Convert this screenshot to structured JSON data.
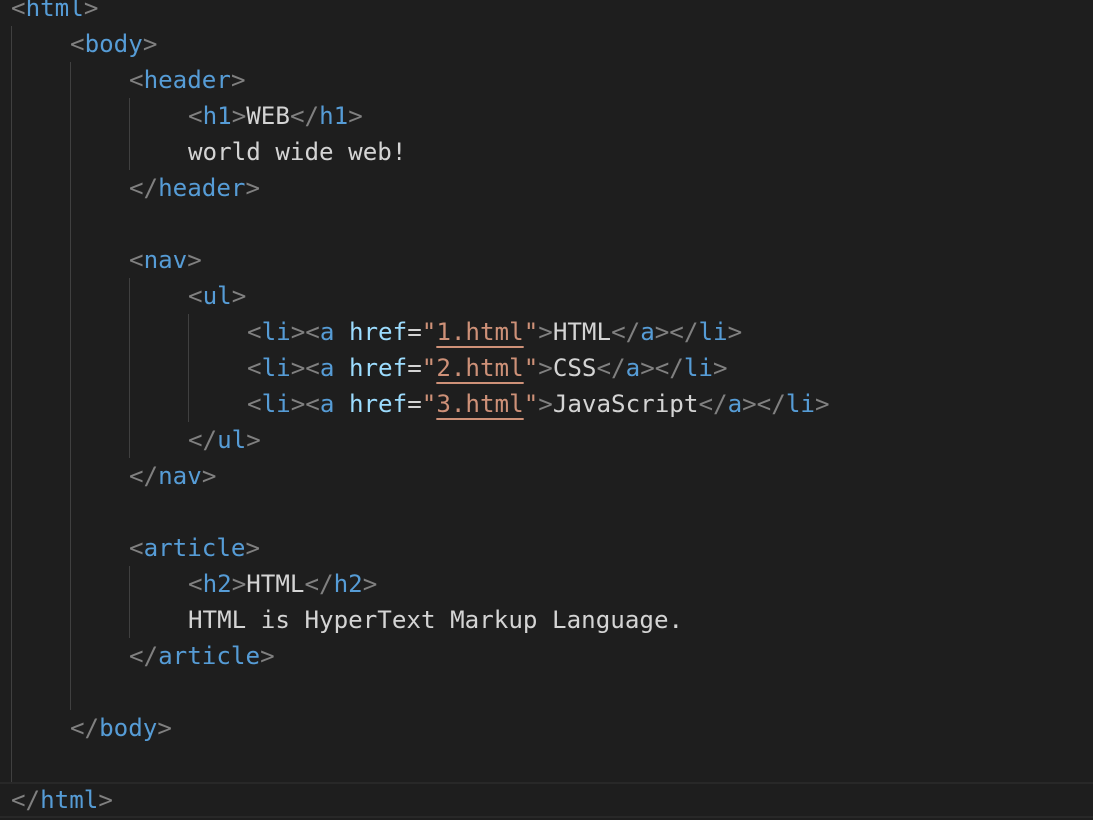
{
  "editor": {
    "theme": "dark",
    "colors": {
      "background": "#1e1e1e",
      "tag": "#569cd6",
      "punctuation": "#808080",
      "attribute": "#9cdcfe",
      "string": "#ce9178",
      "text": "#d4d4d4"
    },
    "code": {
      "html_open": "html",
      "body_open": "body",
      "header_open": "header",
      "h1_open": "h1",
      "h1_text": "WEB",
      "h1_close": "h1",
      "header_text": "world wide web!",
      "header_close": "header",
      "nav_open": "nav",
      "ul_open": "ul",
      "li_tag": "li",
      "a_tag": "a",
      "href_attr": "href",
      "links": [
        {
          "href": "1.html",
          "text": "HTML"
        },
        {
          "href": "2.html",
          "text": "CSS"
        },
        {
          "href": "3.html",
          "text": "JavaScript"
        }
      ],
      "ul_close": "ul",
      "nav_close": "nav",
      "article_open": "article",
      "h2_open": "h2",
      "h2_text": "HTML",
      "h2_close": "h2",
      "article_text": "HTML is HyperText Markup Language.",
      "article_close": "article",
      "body_close": "body",
      "html_close": "html"
    }
  }
}
